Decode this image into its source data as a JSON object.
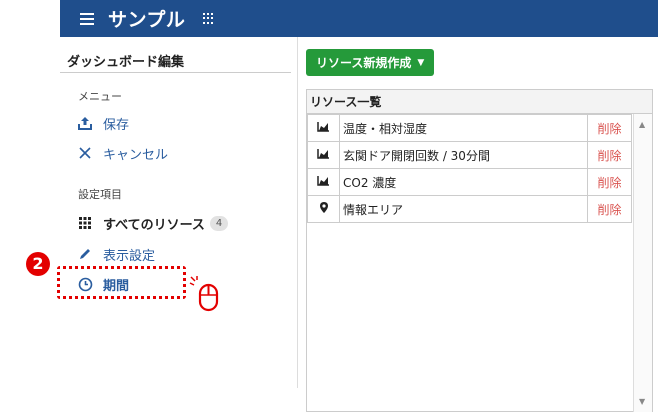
{
  "header": {
    "title": "サンプル",
    "menu_icon": "hamburger-icon",
    "apps_icon": "grid-icon",
    "color": "#1f4e8c"
  },
  "sidebar": {
    "title": "ダッシュボード編集",
    "menu_section": "メニュー",
    "save": "保存",
    "cancel": "キャンセル",
    "settings_section": "設定項目",
    "all_resources": "すべてのリソース",
    "all_resources_count": "4",
    "display_settings": "表示設定",
    "period": "期間"
  },
  "annotation": {
    "step": "2",
    "color": "#e30000"
  },
  "main": {
    "create_button": "リソース新規作成",
    "panel_title": "リソース一覧",
    "rows": [
      {
        "icon": "area-chart-icon",
        "name": "温度・相対湿度",
        "action": "削除"
      },
      {
        "icon": "area-chart-icon",
        "name": "玄関ドア開閉回数 / 30分間",
        "action": "削除"
      },
      {
        "icon": "area-chart-icon",
        "name": "CO2 濃度",
        "action": "削除"
      },
      {
        "icon": "map-marker-icon",
        "name": "情報エリア",
        "action": "削除"
      }
    ]
  },
  "colors": {
    "accent_green": "#259a3a",
    "delete_red": "#d9534f",
    "link_blue": "#2a5d9f"
  }
}
